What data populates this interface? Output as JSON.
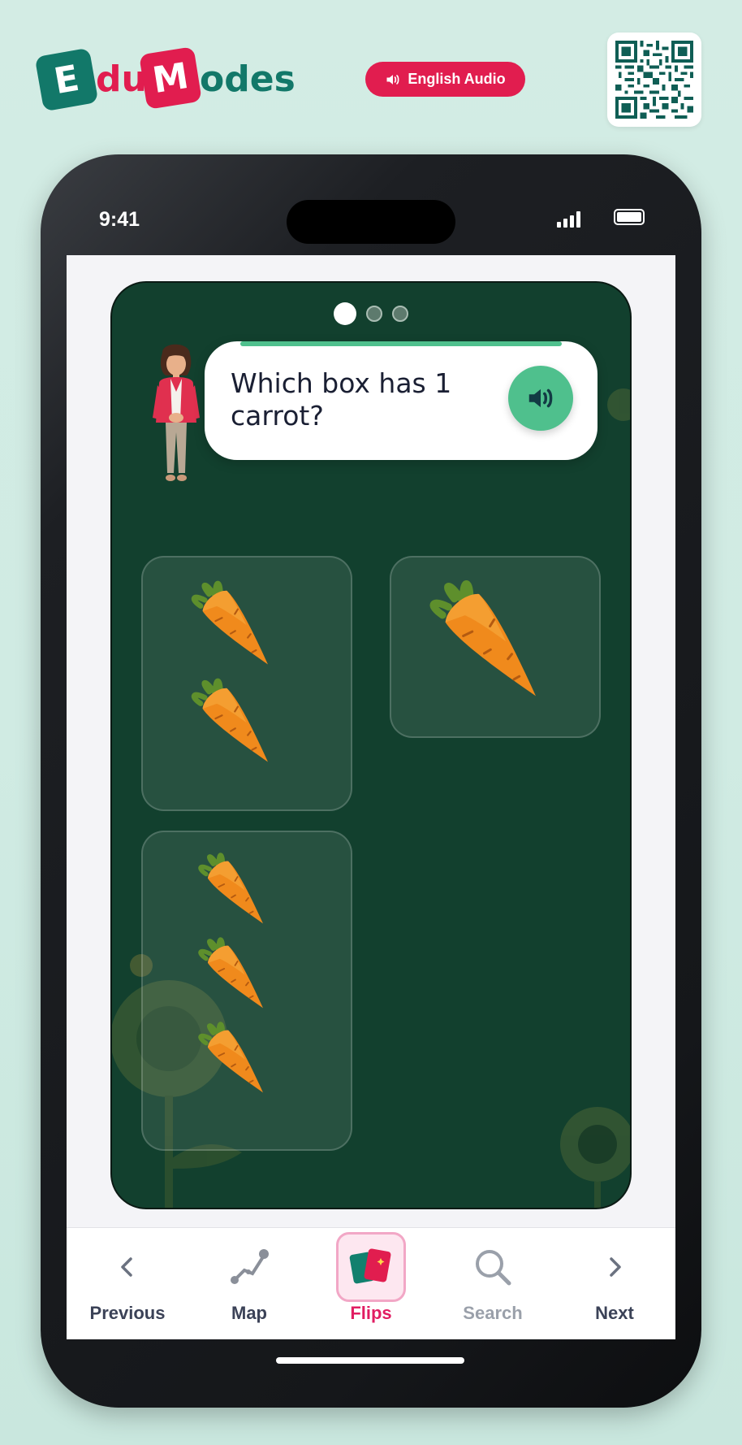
{
  "brand": {
    "tile_e": "E",
    "text_du": "du",
    "tile_m": "M",
    "text_odes": "odes"
  },
  "header": {
    "audio_button_label": "English Audio",
    "qr_icon": "qr-code"
  },
  "status_bar": {
    "time": "9:41"
  },
  "card": {
    "page_dots": 3,
    "active_dot": 1,
    "question": "Which box has 1 carrot?",
    "progress": 1.0,
    "options": [
      {
        "id": "a",
        "carrot_count": 2
      },
      {
        "id": "b",
        "carrot_count": 1
      },
      {
        "id": "c",
        "carrot_count": 3
      }
    ]
  },
  "nav": {
    "items": [
      {
        "label": "Previous",
        "icon": "chevron-left-icon"
      },
      {
        "label": "Map",
        "icon": "route-icon"
      },
      {
        "label": "Flips",
        "icon": "cards-icon"
      },
      {
        "label": "Search",
        "icon": "search-icon"
      },
      {
        "label": "Next",
        "icon": "chevron-right-icon"
      }
    ],
    "active": "Flips"
  },
  "colors": {
    "brand_teal": "#127869",
    "brand_red": "#e11d4f",
    "card_bg": "#12402e",
    "accent_green": "#4fc08d",
    "active_nav": "#e11d62"
  }
}
